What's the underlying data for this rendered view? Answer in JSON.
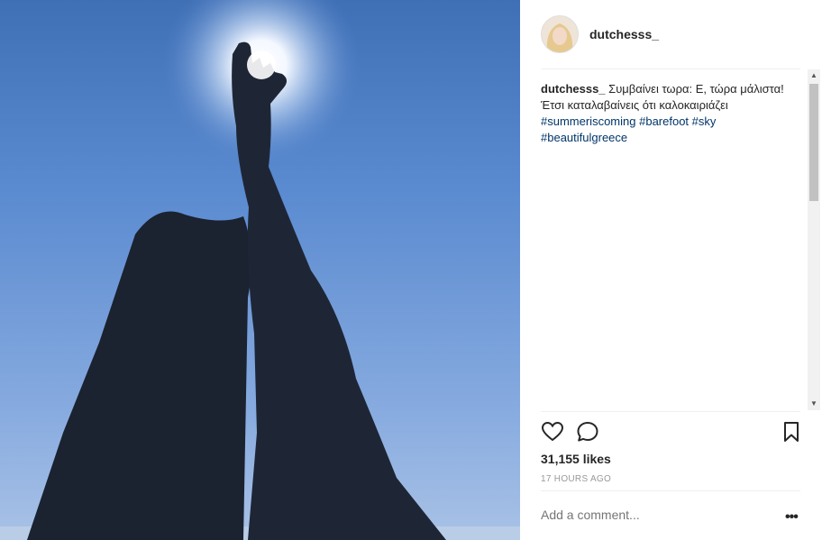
{
  "post": {
    "username": "dutchesss_",
    "caption_text": " Συμβαίνει τωρα: Ε, τώρα μάλιστα! Έτσι καταλαβαίνεις ότι καλοκαιριάζει ",
    "caption_emoji": "",
    "hashtags": [
      "#summeriscoming",
      "#barefoot",
      "#sky",
      "#beautifulgreece"
    ],
    "likes": "31,155 likes",
    "timestamp": "17 HOURS AGO",
    "comment_placeholder": "Add a comment...",
    "more_label": "•••"
  },
  "icons": {
    "like": "heart-icon",
    "comment": "comment-icon",
    "save": "bookmark-icon",
    "more": "more-options-icon"
  },
  "colors": {
    "text": "#262626",
    "hashtag": "#003569",
    "muted": "#999999",
    "divider": "#efefef"
  }
}
